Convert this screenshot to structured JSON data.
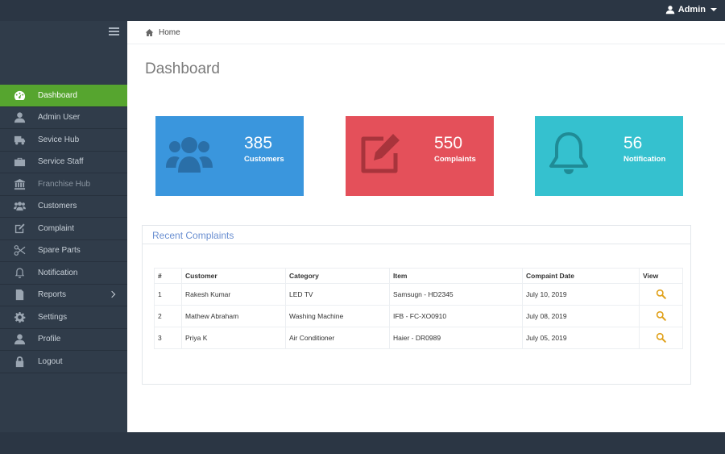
{
  "topbar": {
    "user_label": "Admin"
  },
  "sidebar": {
    "items": [
      {
        "label": "Dashboard",
        "icon": "dashboard-icon",
        "active": true
      },
      {
        "label": "Admin User",
        "icon": "user-icon"
      },
      {
        "label": "Sevice Hub",
        "icon": "truck-icon"
      },
      {
        "label": "Service Staff",
        "icon": "briefcase-icon"
      },
      {
        "label": "Franchise Hub",
        "icon": "bank-icon"
      },
      {
        "label": "Customers",
        "icon": "users-icon"
      },
      {
        "label": "Complaint",
        "icon": "edit-icon"
      },
      {
        "label": "Spare Parts",
        "icon": "scissors-icon"
      },
      {
        "label": "Notification",
        "icon": "bell-icon"
      },
      {
        "label": "Reports",
        "icon": "document-icon",
        "has_submenu": true
      },
      {
        "label": "Settings",
        "icon": "gear-icon"
      },
      {
        "label": "Profile",
        "icon": "user-icon"
      },
      {
        "label": "Logout",
        "icon": "lock-icon"
      }
    ]
  },
  "breadcrumb": {
    "home": "Home"
  },
  "page": {
    "title": "Dashboard"
  },
  "stats": [
    {
      "value": "385",
      "label": "Customers",
      "color": "#3a96dd",
      "icon": "users-icon"
    },
    {
      "value": "550",
      "label": "Complaints",
      "color": "#e4505a",
      "icon": "edit-icon"
    },
    {
      "value": "56",
      "label": "Notification",
      "color": "#35c1cf",
      "icon": "bell-icon"
    }
  ],
  "complaints": {
    "title": "Recent Complaints",
    "headers": [
      "#",
      "Customer",
      "Category",
      "Item",
      "Compaint Date",
      "View"
    ],
    "rows": [
      {
        "num": "1",
        "customer": "Rakesh Kumar",
        "category": "LED TV",
        "item": "Samsugn - HD2345",
        "date": "July 10, 2019"
      },
      {
        "num": "2",
        "customer": "Mathew Abraham",
        "category": "Washing Machine",
        "item": "IFB - FC-XO0910",
        "date": "July 08, 2019"
      },
      {
        "num": "3",
        "customer": "Priya K",
        "category": "Air Conditioner",
        "item": "Haier - DR0989",
        "date": "July 05, 2019"
      }
    ]
  },
  "colors": {
    "accent_green": "#56a52f",
    "sidebar": "#303c4a",
    "topbar": "#2b3644",
    "search_icon": "#e0a11b"
  }
}
